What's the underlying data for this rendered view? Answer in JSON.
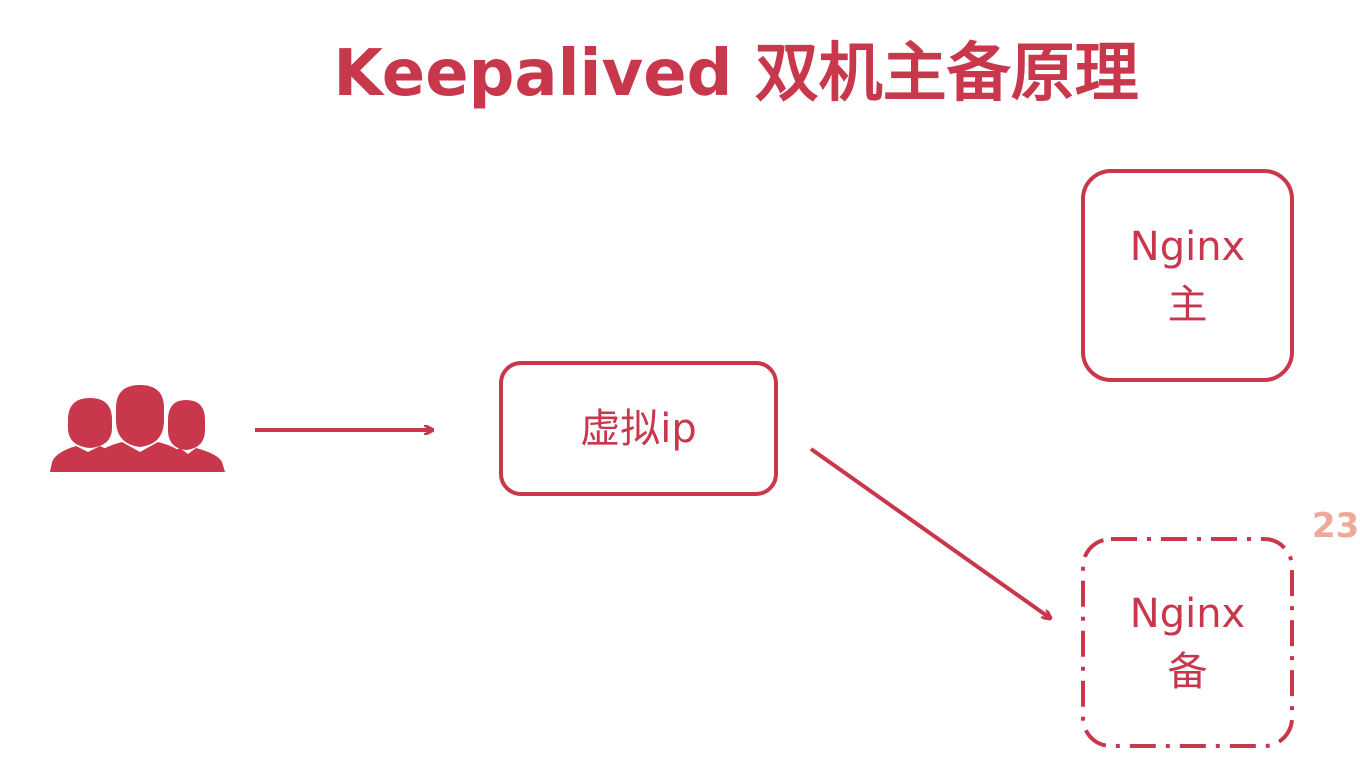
{
  "title": "Keepalived 双机主备原理",
  "nodes": {
    "virtual_ip": {
      "label": "虚拟ip"
    },
    "nginx_master": {
      "line1": "Nginx",
      "line2": "主"
    },
    "nginx_backup": {
      "line1": "Nginx",
      "line2": "备"
    }
  },
  "icons": {
    "users": "users-group-icon"
  },
  "page_number": "23",
  "colors": {
    "accent": "#c8374b",
    "page_number": "#f0a898",
    "background": "#ffffff"
  }
}
